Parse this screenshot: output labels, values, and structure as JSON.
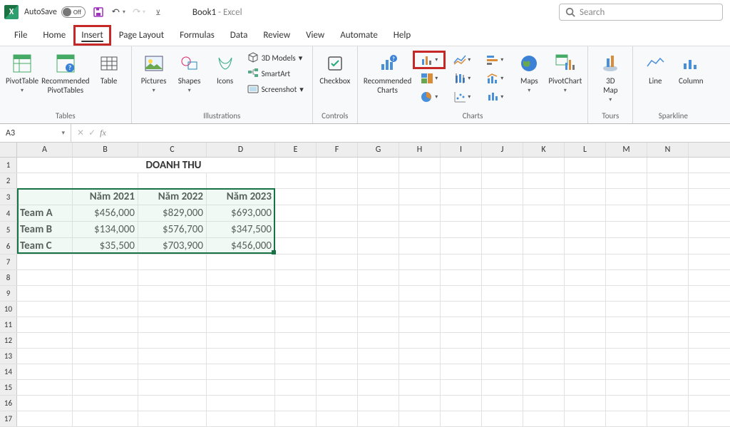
{
  "title": {
    "autosave": "AutoSave",
    "autosave_state": "Off",
    "doc": "Book1",
    "sep": " - ",
    "app": "Excel",
    "search_placeholder": "Search"
  },
  "tabs": {
    "file": "File",
    "home": "Home",
    "insert": "Insert",
    "page_layout": "Page Layout",
    "formulas": "Formulas",
    "data": "Data",
    "review": "Review",
    "view": "View",
    "automate": "Automate",
    "help": "Help"
  },
  "ribbon": {
    "tables": {
      "label": "Tables",
      "pivot": "PivotTable",
      "rec_pivot": "Recommended\nPivotTables",
      "table": "Table"
    },
    "illustrations": {
      "label": "Illustrations",
      "pictures": "Pictures",
      "shapes": "Shapes",
      "icons": "Icons",
      "models": "3D Models",
      "smartart": "SmartArt",
      "screenshot": "Screenshot"
    },
    "controls": {
      "label": "Controls",
      "checkbox": "Checkbox"
    },
    "charts": {
      "label": "Charts",
      "rec_charts": "Recommended\nCharts",
      "maps": "Maps",
      "pivotchart": "PivotChart"
    },
    "tours": {
      "label": "Tours",
      "map3d": "3D\nMap"
    },
    "sparklines": {
      "label": "Sparkline",
      "line": "Line",
      "column": "Column"
    }
  },
  "name_box": "A3",
  "columns": [
    "A",
    "B",
    "C",
    "D",
    "E",
    "F",
    "G",
    "H",
    "I",
    "J",
    "K",
    "L",
    "M",
    "N"
  ],
  "sheet": {
    "title": "DOANH THU",
    "headers": {
      "y2021": "Năm 2021",
      "y2022": "Năm 2022",
      "y2023": "Năm 2023"
    },
    "rows": [
      {
        "name": "Team A",
        "y2021": "$456,000",
        "y2022": "$829,000",
        "y2023": "$693,000"
      },
      {
        "name": "Team B",
        "y2021": "$134,000",
        "y2022": "$576,700",
        "y2023": "$347,500"
      },
      {
        "name": "Team C",
        "y2021": "$35,500",
        "y2022": "$703,900",
        "y2023": "$456,000"
      }
    ]
  },
  "selection": {
    "ref": "A3:D6"
  },
  "chart_data": {
    "type": "table",
    "title": "DOANH THU",
    "categories": [
      "Năm 2021",
      "Năm 2022",
      "Năm 2023"
    ],
    "series": [
      {
        "name": "Team A",
        "values": [
          456000,
          829000,
          693000
        ]
      },
      {
        "name": "Team B",
        "values": [
          134000,
          576700,
          347500
        ]
      },
      {
        "name": "Team C",
        "values": [
          35500,
          703900,
          456000
        ]
      }
    ],
    "unit": "USD"
  }
}
